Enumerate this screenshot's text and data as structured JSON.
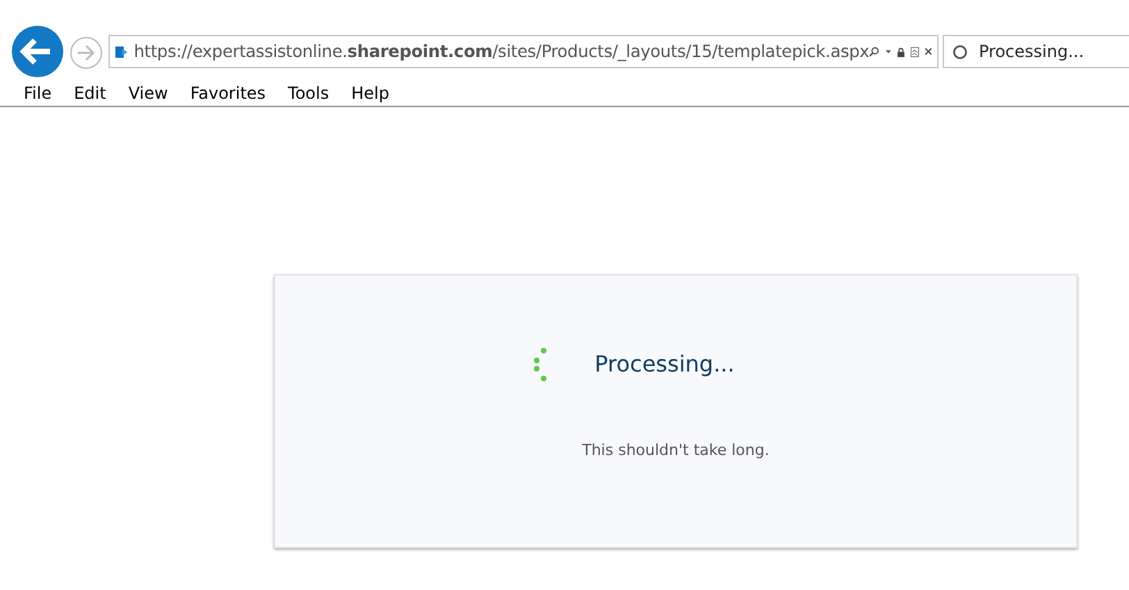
{
  "address_bar": {
    "url": "https://expertassistonline.**sharepoint.com**/sites/Products/_layouts/15/templatepick.aspx"
  },
  "tab": {
    "title": "Processing..."
  },
  "menu": [
    "File",
    "Edit",
    "View",
    "Favorites",
    "Tools",
    "Help"
  ],
  "dialog": {
    "title": "Processing...",
    "message": "This shouldn't take long."
  }
}
